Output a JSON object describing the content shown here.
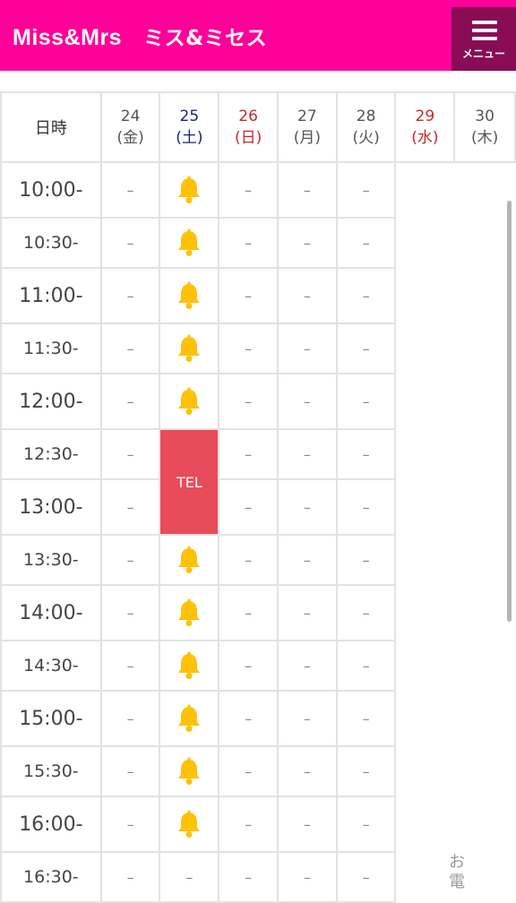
{
  "header": {
    "logo_en": "Miss&Mrs",
    "logo_jp": "ミス&ミセス",
    "menu_label": "メニュー"
  },
  "table": {
    "corner_label": "日時",
    "days": [
      {
        "date": "24",
        "weekday": "(金)",
        "type": "normal"
      },
      {
        "date": "25",
        "weekday": "(土)",
        "type": "sat"
      },
      {
        "date": "26",
        "weekday": "(日)",
        "type": "sun"
      },
      {
        "date": "27",
        "weekday": "(月)",
        "type": "normal"
      },
      {
        "date": "28",
        "weekday": "(火)",
        "type": "normal"
      },
      {
        "date": "29",
        "weekday": "(水)",
        "type": "hol"
      },
      {
        "date": "30",
        "weekday": "(木)",
        "type": "normal"
      }
    ],
    "rows": [
      {
        "time": "10:00-",
        "cells": [
          "–",
          "bell",
          "–",
          "–",
          "–"
        ]
      },
      {
        "time": "10:30-",
        "cells": [
          "–",
          "bell",
          "–",
          "–",
          "–"
        ]
      },
      {
        "time": "11:00-",
        "cells": [
          "–",
          "bell",
          "–",
          "–",
          "–"
        ]
      },
      {
        "time": "11:30-",
        "cells": [
          "–",
          "bell",
          "–",
          "–",
          "–"
        ]
      },
      {
        "time": "12:00-",
        "cells": [
          "–",
          "bell",
          "–",
          "–",
          "–"
        ]
      },
      {
        "time": "12:30-",
        "cells": [
          "–",
          "tel",
          "–",
          "–",
          "–"
        ]
      },
      {
        "time": "13:00-",
        "cells": [
          "–",
          "tel",
          "–",
          "–",
          "–"
        ]
      },
      {
        "time": "13:30-",
        "cells": [
          "–",
          "bell",
          "–",
          "–",
          "–"
        ]
      },
      {
        "time": "14:00-",
        "cells": [
          "–",
          "bell",
          "–",
          "–",
          "–"
        ]
      },
      {
        "time": "14:30-",
        "cells": [
          "–",
          "bell",
          "–",
          "–",
          "–"
        ]
      },
      {
        "time": "15:00-",
        "cells": [
          "–",
          "bell",
          "–",
          "–",
          "–"
        ]
      },
      {
        "time": "15:30-",
        "cells": [
          "–",
          "bell",
          "–",
          "–",
          "–"
        ]
      },
      {
        "time": "16:00-",
        "cells": [
          "–",
          "bell",
          "–",
          "–",
          "–"
        ]
      },
      {
        "time": "16:30-",
        "cells": [
          "–",
          "–",
          "–",
          "–",
          "–"
        ]
      }
    ],
    "tel_label": "TEL",
    "unavailable_text": "お電"
  },
  "colors": {
    "brand": "#ff0099",
    "menu_bg": "#8a0c55",
    "tel_bg": "#e84b5a",
    "bell": "#ffc107",
    "saturday": "#1a237e",
    "sunday_holiday": "#c62828"
  },
  "icons": {
    "menu": "hamburger-icon",
    "available": "bell-icon"
  }
}
